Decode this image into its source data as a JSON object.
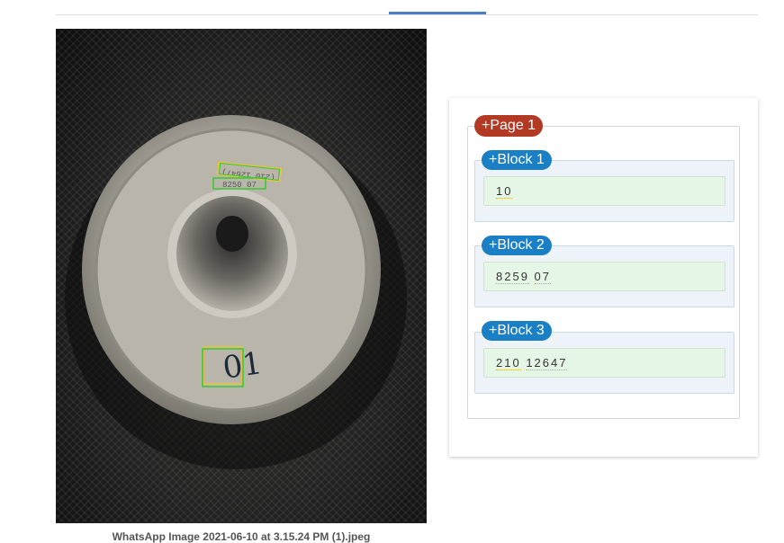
{
  "caption": "WhatsApp Image 2021-06-10 at 3.15.24 PM (1).jpeg",
  "photo_overlay_text": {
    "line1": "(210 12647)",
    "line2": "8250 07",
    "bottom_mark": "01"
  },
  "colors": {
    "tab_indicator": "#4a7fc8",
    "page_tag": "#b23a23",
    "block_tag": "#1a7fc4",
    "block_bg": "#edf3f8",
    "text_bg": "#e6f6e6",
    "detection_box_green": "#33cc33",
    "detection_box_yellow": "#e8c33a"
  },
  "result": {
    "page_label": "+Page 1",
    "blocks": [
      {
        "label": "+Block 1",
        "words": [
          "10"
        ]
      },
      {
        "label": "+Block 2",
        "words": [
          "8259",
          "07"
        ]
      },
      {
        "label": "+Block 3",
        "words": [
          "210",
          "12647"
        ]
      }
    ]
  }
}
